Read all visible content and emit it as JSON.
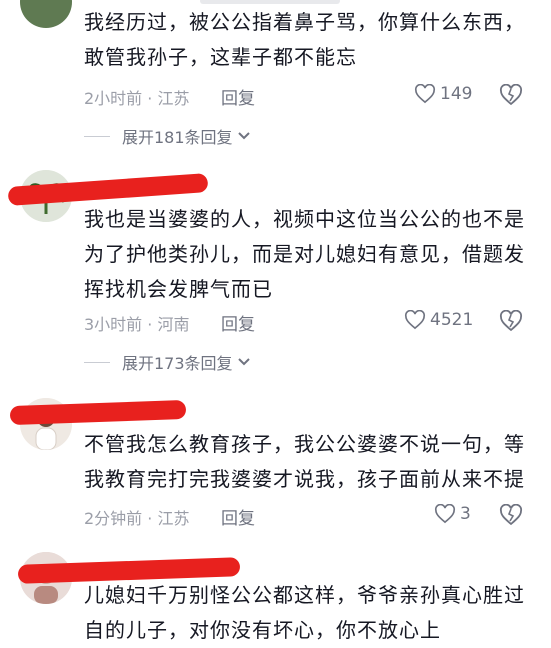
{
  "comments": [
    {
      "text": "我经历过，被公公指着鼻子骂，你算什么东西，敢管我孙子，这辈子都不能忘",
      "meta": "2小时前 · 江苏",
      "reply": "回复",
      "likes": "149",
      "expand": "展开181条回复"
    },
    {
      "text": "我也是当婆婆的人，视频中这位当公公的也不是为了护他类孙儿，而是对儿媳妇有意见，借题发挥找机会发脾气而已",
      "meta": "3小时前 · 河南",
      "reply": "回复",
      "likes": "4521",
      "expand": "展开173条回复"
    },
    {
      "text": "不管我怎么教育孩子，我公公婆婆不说一句，等我教育完打完我婆婆才说我，孩子面前从来不提",
      "meta": "2分钟前 · 江苏",
      "reply": "回复",
      "likes": "3"
    },
    {
      "text": "儿媳妇千万别怪公公都这样，爷爷亲孙真心胜过自的儿子，对你没有坏心，你不放心上"
    }
  ],
  "colors": {
    "redact": "#e8211e",
    "meta": "#9b9ea8",
    "text": "#161823"
  }
}
